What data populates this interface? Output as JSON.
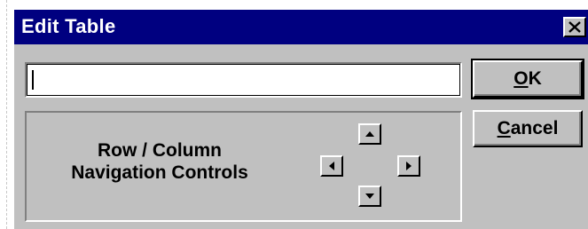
{
  "window": {
    "title": "Edit Table",
    "close_icon": "close-x-icon"
  },
  "input": {
    "value": "",
    "placeholder": ""
  },
  "buttons": {
    "ok": {
      "underlined": "O",
      "rest": "K"
    },
    "cancel": {
      "underlined": "C",
      "rest": "ancel"
    }
  },
  "group": {
    "label_line1": "Row / Column",
    "label_line2": "Navigation Controls"
  },
  "nav": {
    "up_icon": "arrow-up-icon",
    "down_icon": "arrow-down-icon",
    "left_icon": "arrow-left-icon",
    "right_icon": "arrow-right-icon"
  },
  "colors": {
    "titlebar": "#000080",
    "face": "#c0c0c0"
  }
}
